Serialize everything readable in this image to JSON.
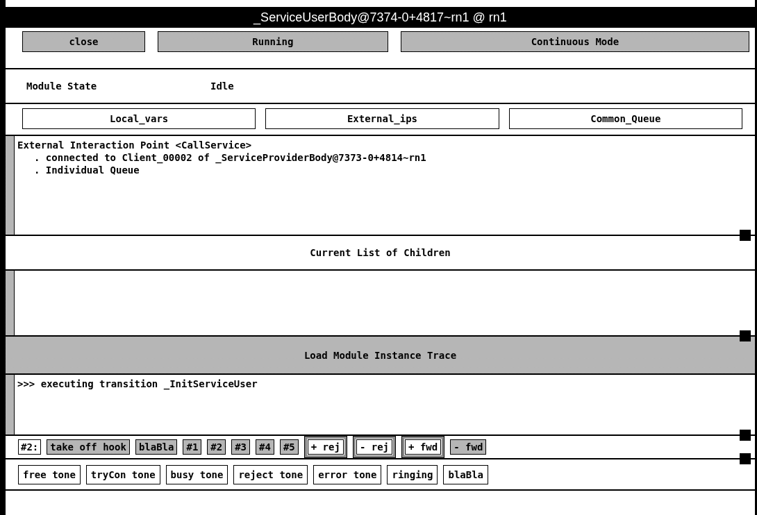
{
  "window": {
    "title": "_ServiceUserBody@7374-0+4817~rn1 @ rn1"
  },
  "top_buttons": [
    {
      "label": "close",
      "disabled": true
    },
    {
      "label": "Running",
      "disabled": true
    },
    {
      "label": "Continuous Mode",
      "disabled": true
    }
  ],
  "module_state": {
    "label": "Module State",
    "value": "Idle"
  },
  "view_buttons": [
    {
      "label": "Local_vars"
    },
    {
      "label": "External_ips"
    },
    {
      "label": "Common_Queue"
    }
  ],
  "info_panel": {
    "lines": [
      {
        "text": "External Interaction Point <CallService>",
        "children": [
          {
            "bullet": ".",
            "text": "connected to Client_00002 of _ServiceProviderBody@7373-0+4814~rn1"
          },
          {
            "bullet": ".",
            "text": "Individual Queue"
          }
        ]
      }
    ]
  },
  "children_panel": {
    "title": "Current List of Children",
    "disabled": false
  },
  "trace_panel": {
    "title": "Load Module Instance Trace",
    "disabled": true,
    "lines": [
      ">>> executing transition _InitServiceUser"
    ]
  },
  "action_bar": {
    "label": "#2:",
    "buttons": [
      {
        "label": "take off hook",
        "kind": "plain",
        "disabled": true
      },
      {
        "label": "blaBla",
        "kind": "plain",
        "disabled": true
      },
      {
        "label": "#1",
        "kind": "plain",
        "disabled": true
      },
      {
        "label": "#2",
        "kind": "plain",
        "disabled": true
      },
      {
        "label": "#3",
        "kind": "plain",
        "disabled": true
      },
      {
        "label": "#4",
        "kind": "plain",
        "disabled": true
      },
      {
        "label": "#5",
        "kind": "plain",
        "disabled": true
      },
      {
        "label": "+ rej",
        "kind": "framed",
        "disabled": false
      },
      {
        "label": "- rej",
        "kind": "framed",
        "disabled": false
      },
      {
        "label": "+ fwd",
        "kind": "framed",
        "disabled": false
      },
      {
        "label": "- fwd",
        "kind": "plain",
        "disabled": true
      }
    ]
  },
  "tone_buttons": [
    {
      "label": "free tone"
    },
    {
      "label": "tryCon tone"
    },
    {
      "label": "busy tone"
    },
    {
      "label": "reject tone"
    },
    {
      "label": "error tone"
    },
    {
      "label": "ringing"
    },
    {
      "label": "blaBla"
    }
  ]
}
